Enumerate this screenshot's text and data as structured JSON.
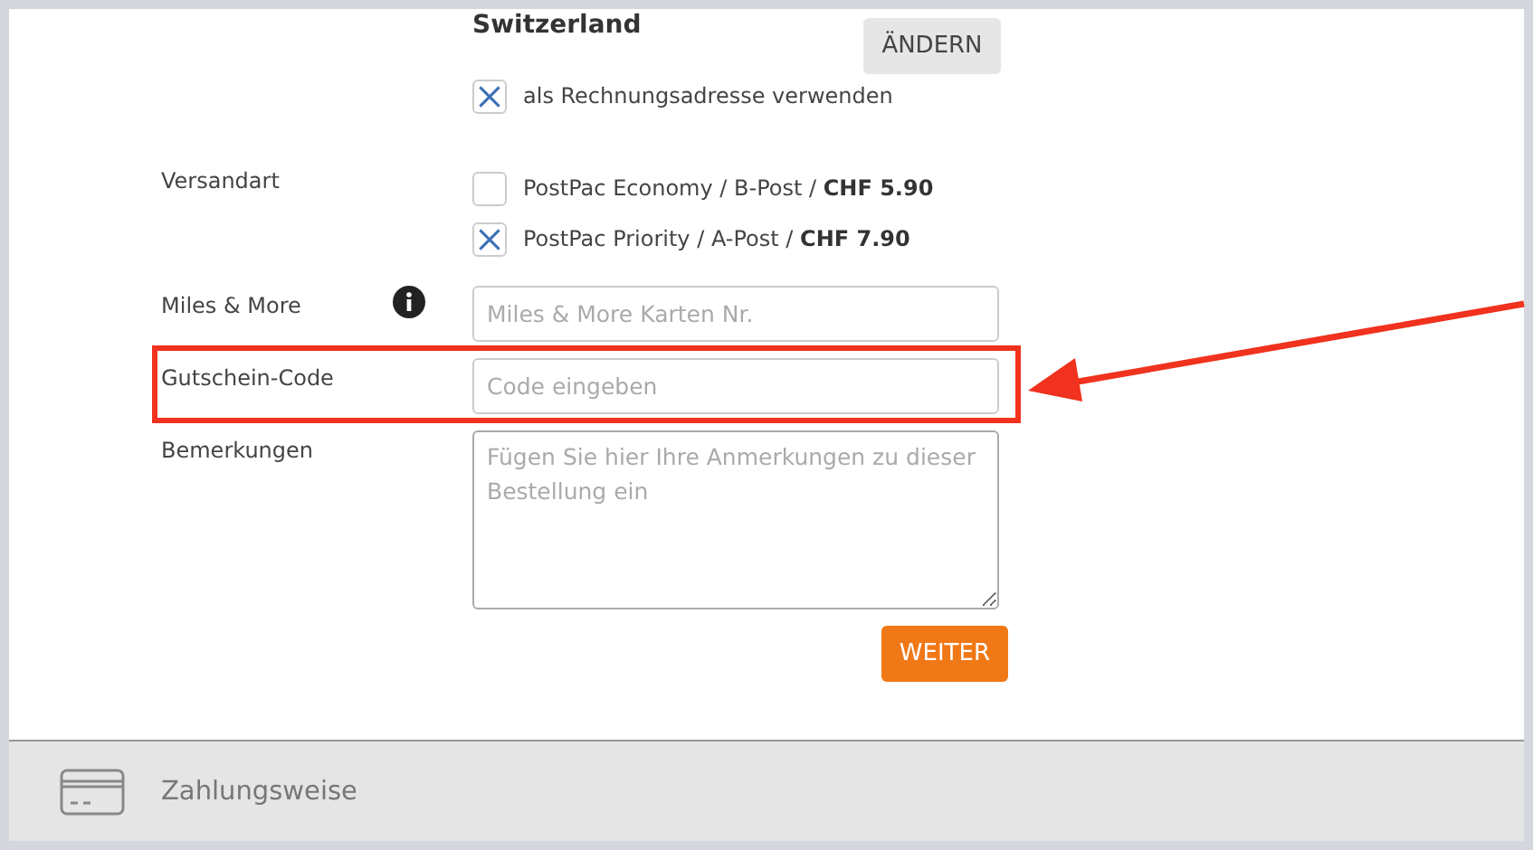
{
  "address": {
    "country": "Switzerland",
    "change_button": "ÄNDERN",
    "billing_checkbox": {
      "label": "als Rechnungsadresse verwenden",
      "checked": true
    }
  },
  "shipping": {
    "label": "Versandart",
    "options": [
      {
        "label": "PostPac Economy / B-Post / **CHF 5.90**",
        "checked": false
      },
      {
        "label": "PostPac Priority / A-Post / **CHF 7.90**",
        "checked": true
      }
    ]
  },
  "fields": [
    {
      "kind": "input",
      "label": "Miles & More",
      "info": true,
      "placeholder": "Miles & More Karten Nr.",
      "highlighted": false
    },
    {
      "kind": "input",
      "label": "Gutschein-Code",
      "info": false,
      "placeholder": "Code eingeben",
      "highlighted": true
    },
    {
      "kind": "textarea",
      "label": "Bemerkungen",
      "info": false,
      "placeholder": "Fügen Sie hier Ihre Anmerkungen zu dieser Bestellung ein",
      "highlighted": false
    }
  ],
  "next_button": "WEITER",
  "next_section": {
    "title": "Zahlungsweise"
  }
}
